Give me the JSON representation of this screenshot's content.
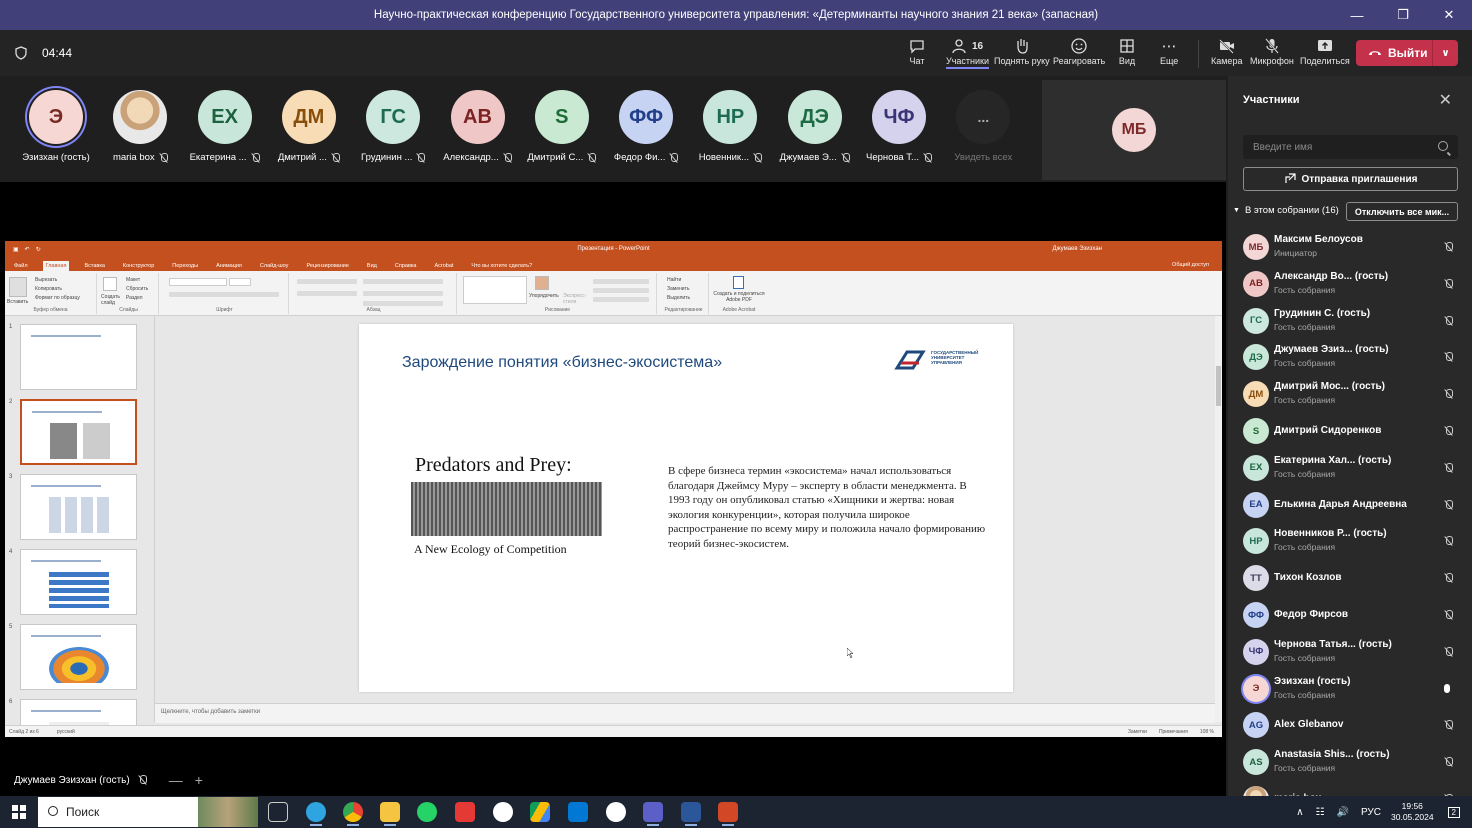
{
  "window": {
    "title": "Научно-практическая конференцию Государственного университета управления: «Детерминанты научного знания 21 века» (запасная)"
  },
  "toolbar": {
    "timer": "04:44",
    "chat": "Чат",
    "participants": "Участники",
    "participants_count": "16",
    "raise_hand": "Поднять руку",
    "react": "Реагировать",
    "view": "Вид",
    "more": "Еще",
    "camera": "Камера",
    "mic": "Микрофон",
    "share": "Поделиться",
    "leave": "Выйти"
  },
  "strip": {
    "tiles": [
      {
        "initials": "Э",
        "name": "Эзизхан (гость)",
        "bg": "#f6d7d4",
        "fg": "#7a2a25",
        "mic": false
      },
      {
        "initials": "",
        "name": "maria box",
        "bg": "#d9c7b1",
        "fg": "#333",
        "photo": true,
        "mic": true
      },
      {
        "initials": "ЕХ",
        "name": "Екатерина ...",
        "bg": "#c8e6d9",
        "fg": "#1d6140",
        "mic": true
      },
      {
        "initials": "ДМ",
        "name": "Дмитрий ...",
        "bg": "#f8dcb6",
        "fg": "#8a4e0c",
        "mic": true
      },
      {
        "initials": "ГС",
        "name": "Грудинин ...",
        "bg": "#cde8de",
        "fg": "#1d6b53",
        "mic": true
      },
      {
        "initials": "АВ",
        "name": "Александр...",
        "bg": "#f0c7c7",
        "fg": "#7d2323",
        "mic": true
      },
      {
        "initials": "S",
        "name": "Дмитрий С...",
        "bg": "#c9e9d2",
        "fg": "#1d6b36",
        "mic": true
      },
      {
        "initials": "ФФ",
        "name": "Федор Фи...",
        "bg": "#c7d3f2",
        "fg": "#233f8a",
        "mic": true
      },
      {
        "initials": "НР",
        "name": "Новенник...",
        "bg": "#c9e6dc",
        "fg": "#1d6b52",
        "mic": true
      },
      {
        "initials": "ДЭ",
        "name": "Джумаев Э...",
        "bg": "#c9e8d9",
        "fg": "#1d6b45",
        "mic": true
      },
      {
        "initials": "ЧФ",
        "name": "Чернова Т...",
        "bg": "#d4d2ec",
        "fg": "#3b3577",
        "mic": true
      },
      {
        "initials": "...",
        "name": "Увидеть всех",
        "bg": "#262626",
        "fg": "#aaa",
        "mic": false
      }
    ],
    "featured": {
      "initials": "МБ",
      "bg": "#f3d6d6",
      "fg": "#7d2a2a"
    }
  },
  "ppt": {
    "title": "Презентация - PowerPoint",
    "user": "Джумаев Эзизхан",
    "tabs": [
      "Файл",
      "Главная",
      "Вставка",
      "Конструктор",
      "Переходы",
      "Анимация",
      "Слайд-шоу",
      "Рецензирование",
      "Вид",
      "Справка",
      "Acrobat",
      "Что вы хотите сделать?"
    ],
    "share": "Общий доступ",
    "groups": [
      "Буфер обмена",
      "Слайды",
      "Шрифт",
      "Абзац",
      "Рисование",
      "Редактирование",
      "Adobe Acrobat"
    ],
    "clipboard": {
      "paste": "Вставить",
      "cut": "Вырезать",
      "copy": "Копировать",
      "format": "Формат по образцу"
    },
    "slides_group": {
      "new": "Создать слайд",
      "layout": "Макет",
      "reset": "Сбросить",
      "section": "Раздел"
    },
    "editing": {
      "find": "Найти",
      "replace": "Заменить",
      "select": "Выделить"
    },
    "acrobat": "Создать и поделиться Adobe PDF",
    "arrange": "Упорядочить",
    "express": "Экспресс-стили",
    "slide": {
      "title": "Зарождение понятия «бизнес-экосистема»",
      "logo_text": "ГОСУДАРСТВЕННЫЙ УНИВЕРСИТЕТ УПРАВЛЕНИЯ",
      "book_title": "Predators and Prey:",
      "book_sub": "A New Ecology of Competition",
      "body": "В сфере бизнеса термин «экосистема» начал использоваться благодаря Джеймсу Муру – эксперту в области менеджмента. В 1993 году он опубликовал статью «Хищники и жертва: новая экология конкуренции», которая получила широкое распространение по всему миру и положила начало формированию теорий бизнес-экосистем."
    },
    "notes": "Щелкните, чтобы добавить заметки",
    "status_slide": "Слайд 2 из 6",
    "status_lang": "русский",
    "status_notes": "Заметки",
    "status_comments": "Примечания",
    "zoom": "108 %"
  },
  "presenter": {
    "name": "Джумаев Эзизхан (гость)"
  },
  "panel": {
    "title": "Участники",
    "search_placeholder": "Введите имя",
    "invite": "Отправка приглашения",
    "in_meeting": "В этом собрании (16)",
    "mute_all": "Отключить все мик...",
    "people": [
      {
        "initials": "МБ",
        "name": "Максим Белоусов",
        "sub": "Инициатор",
        "bg": "#f3d6d6",
        "fg": "#7d2a2a"
      },
      {
        "initials": "АВ",
        "name": "Александр Во... (гость)",
        "sub": "Гость собрания",
        "bg": "#f0c7c7",
        "fg": "#7d2323"
      },
      {
        "initials": "ГС",
        "name": "Грудинин С. (гость)",
        "sub": "Гость собрания",
        "bg": "#cde8de",
        "fg": "#1d6b53"
      },
      {
        "initials": "ДЭ",
        "name": "Джумаев Эзиз... (гость)",
        "sub": "Гость собрания",
        "bg": "#c9e8d9",
        "fg": "#1d6b45"
      },
      {
        "initials": "ДМ",
        "name": "Дмитрий Мос... (гость)",
        "sub": "Гость собрания",
        "bg": "#f8dcb6",
        "fg": "#8a4e0c"
      },
      {
        "initials": "S",
        "name": "Дмитрий Сидоренков",
        "sub": "",
        "bg": "#c9e9d2",
        "fg": "#1d6b36"
      },
      {
        "initials": "ЕХ",
        "name": "Екатерина Хал... (гость)",
        "sub": "Гость собрания",
        "bg": "#c8e6d9",
        "fg": "#1d6140"
      },
      {
        "initials": "ЕА",
        "name": "Елькина Дарья Андреевна",
        "sub": "",
        "bg": "#c7d3f2",
        "fg": "#233f8a"
      },
      {
        "initials": "НР",
        "name": "Новенников Р... (гость)",
        "sub": "Гость собрания",
        "bg": "#c9e6dc",
        "fg": "#1d6b52"
      },
      {
        "initials": "ТТ",
        "name": "Тихон Козлов",
        "sub": "",
        "bg": "#dcdce8",
        "fg": "#3d3d5a"
      },
      {
        "initials": "ФФ",
        "name": "Федор Фирсов",
        "sub": "",
        "bg": "#c7d3f2",
        "fg": "#233f8a"
      },
      {
        "initials": "ЧФ",
        "name": "Чернова Татья... (гость)",
        "sub": "Гость собрания",
        "bg": "#d4d2ec",
        "fg": "#3b3577"
      },
      {
        "initials": "Э",
        "name": "Эзизхан (гость)",
        "sub": "Гость собрания",
        "bg": "#f6d7d4",
        "fg": "#7a2a25",
        "active": true
      },
      {
        "initials": "AG",
        "name": "Alex Glebanov",
        "sub": "",
        "bg": "#c7d3f2",
        "fg": "#233f8a"
      },
      {
        "initials": "AS",
        "name": "Anastasia Shis... (гость)",
        "sub": "Гость собрания",
        "bg": "#c8e6d9",
        "fg": "#1d6140"
      },
      {
        "initials": "",
        "name": "maria box",
        "sub": "",
        "bg": "#d9c7b1",
        "fg": "#333"
      }
    ]
  },
  "taskbar": {
    "search": "Поиск",
    "lang": "РУС",
    "time": "19:56",
    "date": "30.05.2024",
    "notifications": "2"
  }
}
